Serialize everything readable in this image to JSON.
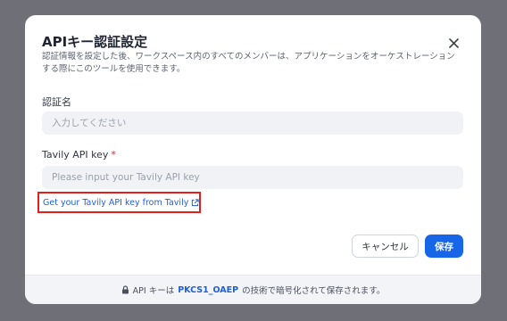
{
  "modal": {
    "title": "APIキー認証設定",
    "description": "認証情報を設定した後、ワークスペース内のすべてのメンバーは、アプリケーションをオーケストレーションする際にこのツールを使用できます。",
    "close_icon": "close-icon"
  },
  "fields": {
    "auth_name": {
      "label": "認証名",
      "value": "",
      "placeholder": "入力してください"
    },
    "api_key": {
      "label": "Tavily API key",
      "required_mark": "*",
      "value": "",
      "placeholder": "Please input your Tavily API key"
    }
  },
  "link": {
    "text": "Get your Tavily API key from Tavily",
    "icon": "external-link-icon"
  },
  "buttons": {
    "cancel": "キャンセル",
    "save": "保存"
  },
  "footer": {
    "icon": "lock-icon",
    "prefix": "API キーは",
    "highlight": "PKCS1_OAEP",
    "suffix": "の技術で暗号化されて保存されます。"
  },
  "colors": {
    "accent": "#1766e8",
    "link": "#1f5fd6",
    "highlight_border": "#e0211b",
    "overlay": "#6f7077"
  }
}
